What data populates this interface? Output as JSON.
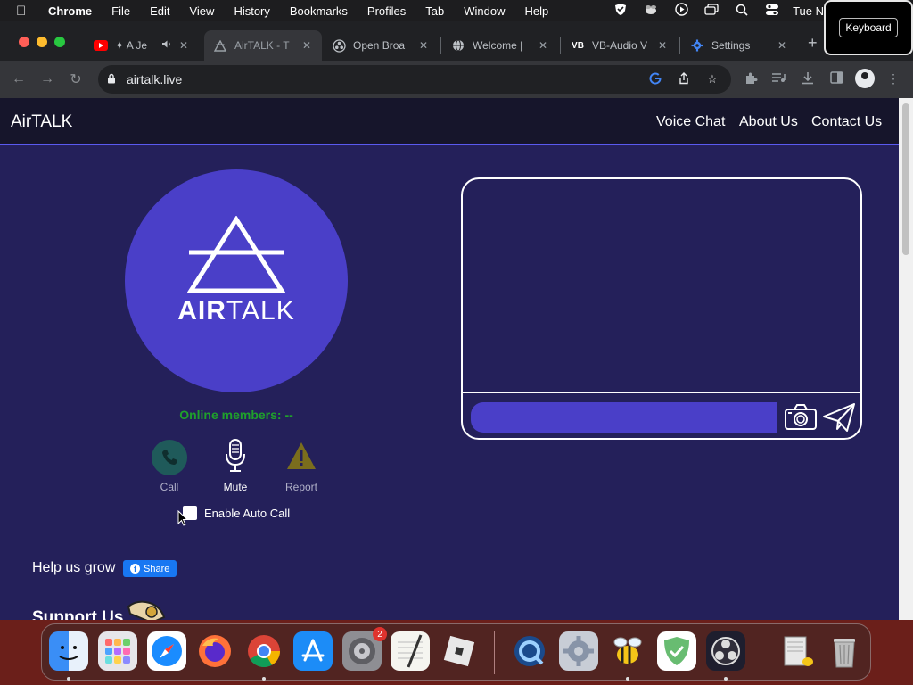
{
  "menubar": {
    "app": "Chrome",
    "items": [
      "File",
      "Edit",
      "View",
      "History",
      "Bookmarks",
      "Profiles",
      "Tab",
      "Window",
      "Help"
    ],
    "clock": "Tue N"
  },
  "keyboard_badge": "Keyboard",
  "tabs": [
    {
      "label": "✦ A Je",
      "icon": "youtube-icon"
    },
    {
      "label": "AirTALK - T",
      "icon": "airtalk-icon"
    },
    {
      "label": "Open Broa",
      "icon": "obs-icon"
    },
    {
      "label": "Welcome |",
      "icon": "globe-icon"
    },
    {
      "label": "VB-Audio V",
      "icon": "vb-audio-icon"
    },
    {
      "label": "Settings",
      "icon": "gear-icon"
    }
  ],
  "browser": {
    "url": "airtalk.live"
  },
  "site": {
    "brand": "AirTALK",
    "nav": [
      "Voice Chat",
      "About Us",
      "Contact Us"
    ],
    "logo_word_bold": "AIR",
    "logo_word_rest": "TALK",
    "online_members": "Online members: --",
    "actions": {
      "call": "Call",
      "mute": "Mute",
      "report": "Report"
    },
    "auto_call_label": "Enable Auto Call",
    "help_grow": "Help us grow",
    "share_label": "Share",
    "support": "Support Us"
  },
  "colors": {
    "page_bg": "#24205a",
    "nav_bg": "#16152b",
    "accent": "#4a3fc8",
    "online_green": "#1fa12b",
    "facebook_blue": "#1877f2"
  },
  "dock": {
    "apps": [
      "finder-icon",
      "launchpad-icon",
      "safari-icon",
      "firefox-icon",
      "chrome-icon",
      "app-store-icon",
      "system-preferences-icon",
      "textedit-icon",
      "roblox-icon",
      "quicktime-icon",
      "gear-app-icon",
      "bee-app-icon",
      "adguard-icon",
      "obs-icon",
      "scanner-icon",
      "trash-icon"
    ],
    "system_preferences_badge": "2"
  }
}
